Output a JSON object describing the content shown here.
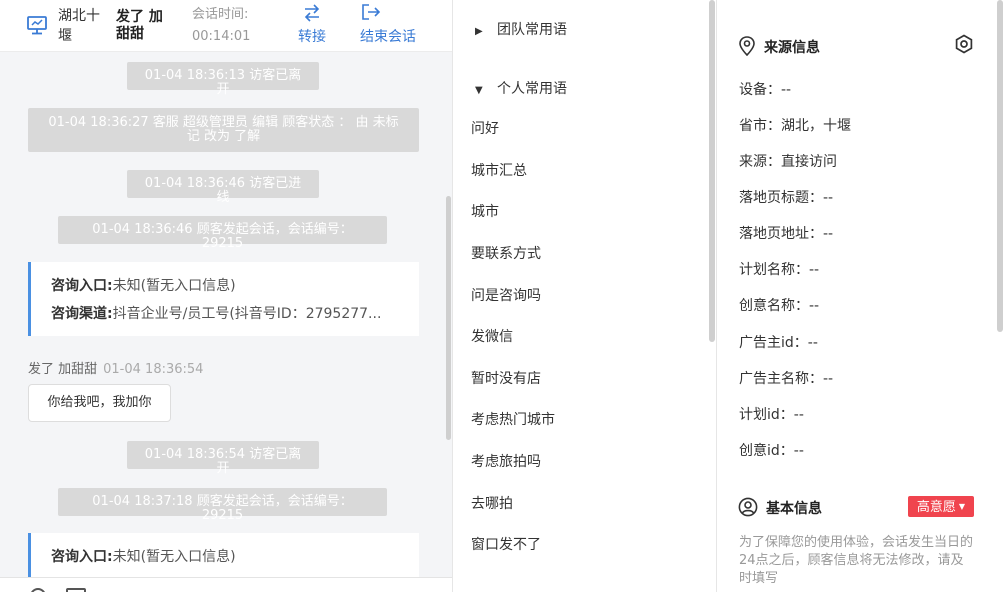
{
  "header": {
    "location": "湖北十堰",
    "visitor_name": "发了 加甜甜",
    "time_label": "会话时间:",
    "time_value": "00:14:01",
    "transfer_label": "转接",
    "end_label": "结束会话",
    "accent_color": "#3a7bd5"
  },
  "chat": {
    "system_messages": [
      "01-04 18:36:13 访客已离开",
      "01-04 18:36:27 客服 超级管理员 编辑 顾客状态 ： 由 未标记 改为 了解",
      "01-04 18:36:46 访客已进线",
      "01-04 18:36:46 顾客发起会话，会话编号：29215",
      "01-04 18:36:54 访客已离开",
      "01-04 18:37:18 顾客发起会话，会话编号：29215"
    ],
    "info_card_1": {
      "entry_label": "咨询入口:",
      "entry_value": "未知(暂无入口信息)",
      "channel_label": "咨询渠道:",
      "channel_value": "抖音企业号/员工号(抖音号ID：2795277..."
    },
    "visitor_msg": {
      "sender": "发了 加甜甜",
      "time": "01-04 18:36:54",
      "text": "你给我吧，我加你"
    },
    "info_card_2": {
      "entry_label": "咨询入口:",
      "entry_value": "未知(暂无入口信息)"
    }
  },
  "phrases": {
    "team_group": "团队常用语",
    "personal_group": "个人常用语",
    "items": [
      "问好",
      "城市汇总",
      "城市",
      "要联系方式",
      "问是咨询吗",
      "发微信",
      "暂时没有店",
      "考虑热门城市",
      "考虑旅拍吗",
      "去哪拍",
      "窗口发不了"
    ]
  },
  "source_info": {
    "title": "来源信息",
    "fields": [
      "设备：--",
      "省市：湖北，十堰",
      "来源：直接访问",
      "落地页标题：--",
      "落地页地址：--",
      "计划名称：--",
      "创意名称：--",
      "广告主id：--",
      "广告主名称：--",
      "计划id：--",
      "创意id：--"
    ]
  },
  "basic_info": {
    "title": "基本信息",
    "intent_badge": "高意愿",
    "badge_color": "#f0444e",
    "note": "为了保障您的使用体验，会话发生当日的24点之后，顾客信息将无法修改，请及时填写"
  }
}
